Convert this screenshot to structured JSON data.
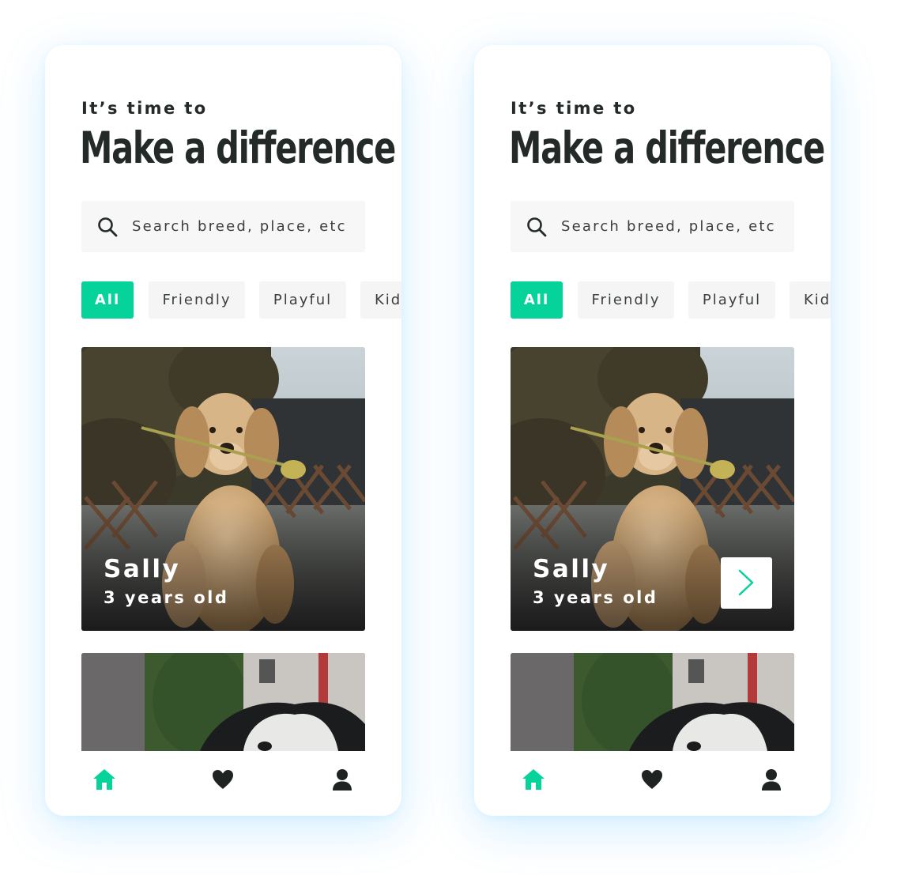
{
  "screens": [
    {
      "eyebrow": "It’s time to",
      "headline": "Make a difference",
      "search": {
        "placeholder": "Search breed, place, etc",
        "icon": "search-icon"
      },
      "filters": [
        {
          "label": "All",
          "active": true
        },
        {
          "label": "Friendly",
          "active": false
        },
        {
          "label": "Playful",
          "active": false
        },
        {
          "label": "Kid",
          "active": false
        }
      ],
      "featured_pet": {
        "name": "Sally",
        "age": "3 years old",
        "show_next_button": false
      },
      "nav": [
        {
          "icon": "home-icon",
          "active": true
        },
        {
          "icon": "heart-icon",
          "active": false
        },
        {
          "icon": "user-icon",
          "active": false
        }
      ]
    },
    {
      "eyebrow": "It’s time to",
      "headline": "Make a difference",
      "search": {
        "placeholder": "Search breed, place, etc",
        "icon": "search-icon"
      },
      "filters": [
        {
          "label": "All",
          "active": true
        },
        {
          "label": "Friendly",
          "active": false
        },
        {
          "label": "Playful",
          "active": false
        },
        {
          "label": "Kid",
          "active": false
        }
      ],
      "featured_pet": {
        "name": "Sally",
        "age": "3 years old",
        "show_next_button": true,
        "next_icon": "chevron-right-icon"
      },
      "nav": [
        {
          "icon": "home-icon",
          "active": true
        },
        {
          "icon": "heart-icon",
          "active": false
        },
        {
          "icon": "user-icon",
          "active": false
        }
      ]
    }
  ],
  "colors": {
    "accent": "#06d39a",
    "text_dark": "#242a28",
    "chip_bg": "#f5f5f5",
    "nav_inactive": "#1f2321"
  }
}
